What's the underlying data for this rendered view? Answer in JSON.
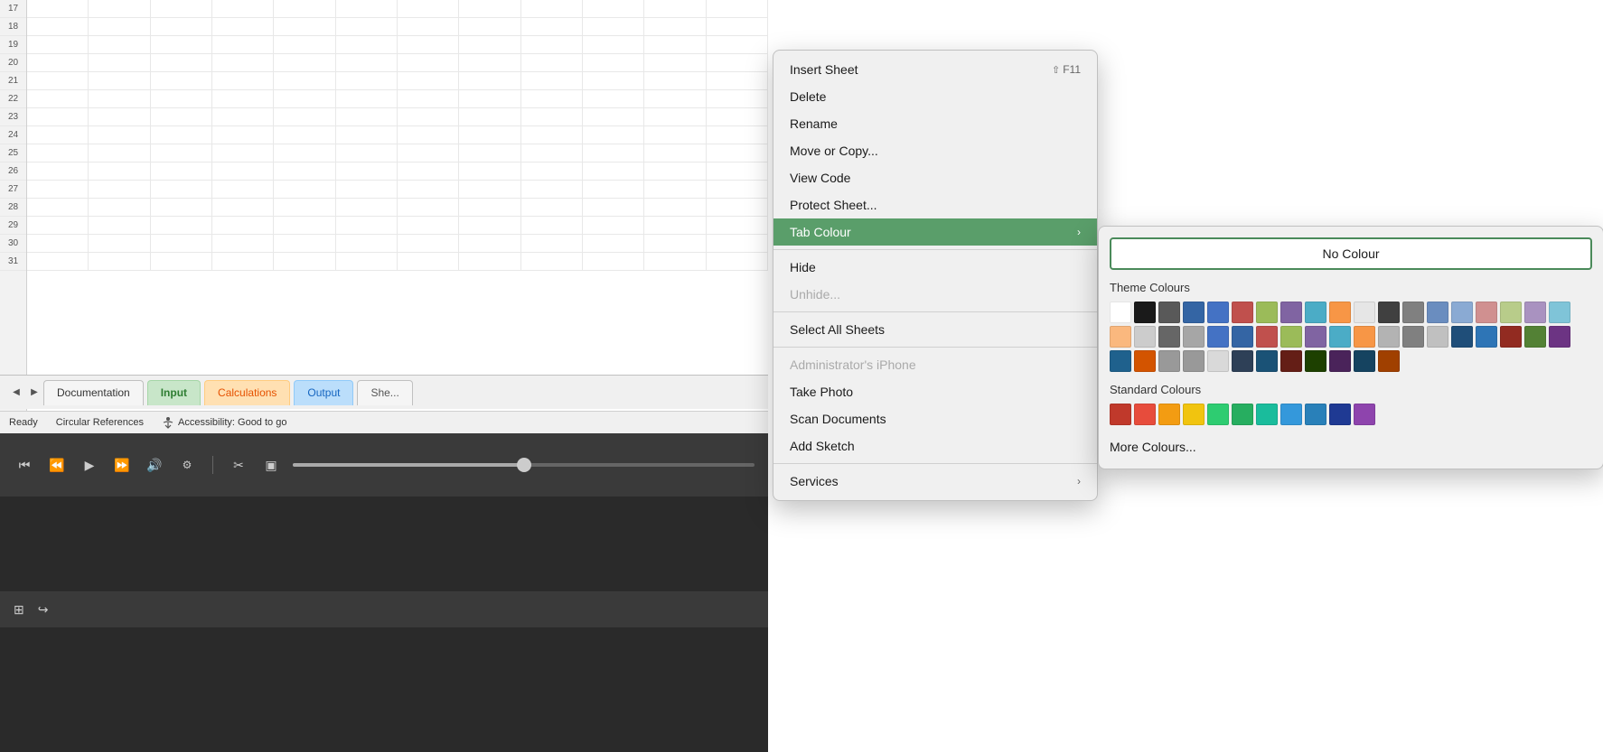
{
  "spreadsheet": {
    "rows": [
      "17",
      "18",
      "19",
      "20",
      "21",
      "22",
      "23",
      "24",
      "25",
      "26",
      "27",
      "28",
      "29",
      "30",
      "31"
    ],
    "status_ready": "Ready",
    "status_circular": "Circular References",
    "status_accessibility": "Accessibility: Good to go"
  },
  "tabs": [
    {
      "label": "Documentation",
      "class": "documentation"
    },
    {
      "label": "Input",
      "class": "input"
    },
    {
      "label": "Calculations",
      "class": "calculations"
    },
    {
      "label": "Output",
      "class": "output"
    },
    {
      "label": "She...",
      "class": "she"
    }
  ],
  "context_menu": {
    "items": [
      {
        "label": "Insert Sheet",
        "shortcut": "⇧F11",
        "id": "insert-sheet",
        "disabled": false
      },
      {
        "label": "Delete",
        "shortcut": "",
        "id": "delete",
        "disabled": false
      },
      {
        "label": "Rename",
        "shortcut": "",
        "id": "rename",
        "disabled": false
      },
      {
        "label": "Move or Copy...",
        "shortcut": "",
        "id": "move-copy",
        "disabled": false
      },
      {
        "label": "View Code",
        "shortcut": "",
        "id": "view-code",
        "disabled": false
      },
      {
        "label": "Protect Sheet...",
        "shortcut": "",
        "id": "protect-sheet",
        "disabled": false
      },
      {
        "label": "Tab Colour",
        "shortcut": "",
        "id": "tab-colour",
        "has_arrow": true,
        "highlighted": true
      },
      {
        "label": "Hide",
        "shortcut": "",
        "id": "hide",
        "disabled": false
      },
      {
        "label": "Unhide...",
        "shortcut": "",
        "id": "unhide",
        "disabled": true
      },
      {
        "label": "Select All Sheets",
        "shortcut": "",
        "id": "select-all",
        "disabled": false
      },
      {
        "label": "Administrator's iPhone",
        "shortcut": "",
        "id": "iphone",
        "disabled": true
      },
      {
        "label": "Take Photo",
        "shortcut": "",
        "id": "take-photo",
        "disabled": false
      },
      {
        "label": "Scan Documents",
        "shortcut": "",
        "id": "scan-docs",
        "disabled": false
      },
      {
        "label": "Add Sketch",
        "shortcut": "",
        "id": "add-sketch",
        "disabled": false
      },
      {
        "label": "Services",
        "shortcut": "",
        "id": "services",
        "has_arrow": true,
        "disabled": false
      }
    ]
  },
  "colour_submenu": {
    "no_colour_label": "No Colour",
    "theme_colours_label": "Theme Colours",
    "standard_colours_label": "Standard Colours",
    "more_colours_label": "More Colours...",
    "theme_colours": [
      "#ffffff",
      "#1a1a1a",
      "#595959",
      "#3465a4",
      "#4472c4",
      "#c0504d",
      "#9bbb59",
      "#8064a2",
      "#4bacc6",
      "#f79646",
      "#e6e6e6",
      "#404040",
      "#808080",
      "#6a8dbf",
      "#8aaad3",
      "#d09090",
      "#b8cc8a",
      "#a992c0",
      "#7fc4d8",
      "#fab87e",
      "#cccccc",
      "#666666",
      "#a6a6a6",
      "#4472c4",
      "#3465a4",
      "#c0504d",
      "#9bbb59",
      "#8064a2",
      "#4bacc6",
      "#f79646",
      "#b3b3b3",
      "#808080",
      "#c0c0c0",
      "#1f4e79",
      "#2e75b6",
      "#922b21",
      "#538135",
      "#6c3483",
      "#1f618d",
      "#d35400",
      "#999999",
      "#999999",
      "#d9d9d9",
      "#2e4057",
      "#1a5276",
      "#641e16",
      "#1d4000",
      "#4a235a",
      "#154360",
      "#a04000"
    ],
    "standard_colours": [
      "#c0392b",
      "#e74c3c",
      "#f39c12",
      "#f1c40f",
      "#2ecc71",
      "#27ae60",
      "#1abc9c",
      "#3498db",
      "#2980b9",
      "#1f3a93",
      "#8e44ad"
    ]
  },
  "media_controls": {
    "buttons": [
      "⏮",
      "⏪",
      "▶",
      "⏩",
      "🔊",
      "⚙",
      "✂",
      "□"
    ]
  }
}
